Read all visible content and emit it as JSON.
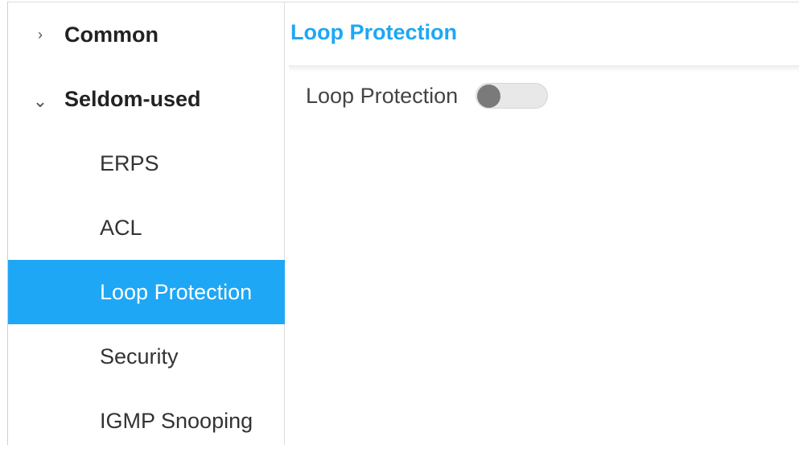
{
  "sidebar": {
    "groups": [
      {
        "label": "Common",
        "chevron": "›",
        "expanded": false
      },
      {
        "label": "Seldom-used",
        "chevron": "⌄",
        "expanded": true
      }
    ],
    "items": [
      {
        "label": "ERPS"
      },
      {
        "label": "ACL"
      },
      {
        "label": "Loop Protection",
        "active": true
      },
      {
        "label": "Security"
      },
      {
        "label": "IGMP Snooping"
      }
    ]
  },
  "main": {
    "title": "Loop Protection",
    "setting": {
      "label": "Loop Protection",
      "enabled": false
    }
  },
  "colors": {
    "accent": "#1ea7f5",
    "toggle_off_track": "#e8e8e8",
    "toggle_off_knob": "#7a7a7a"
  }
}
